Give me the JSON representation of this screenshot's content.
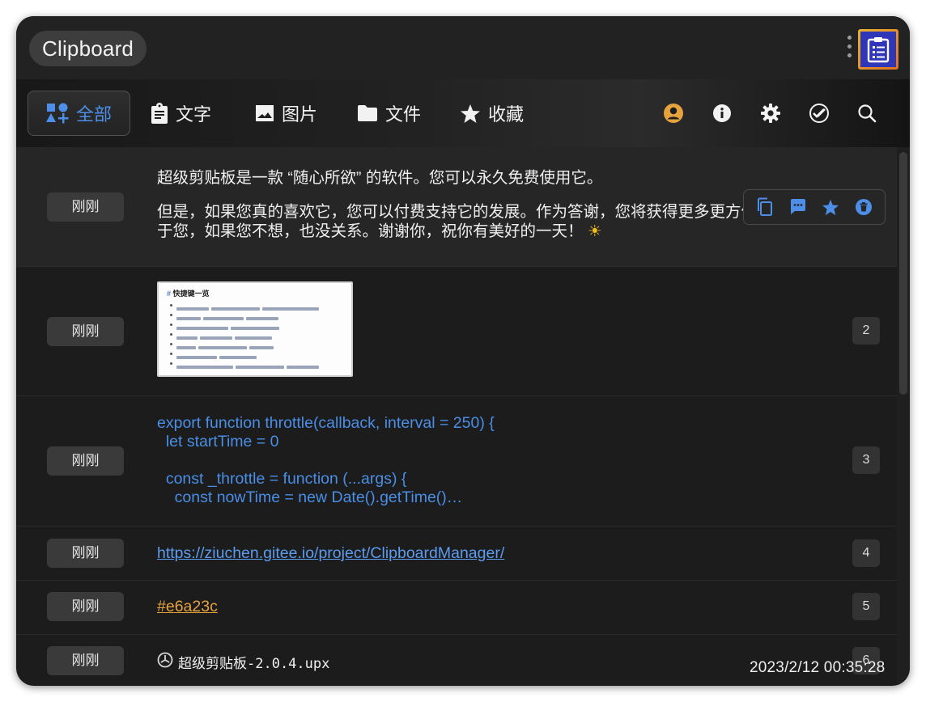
{
  "app": {
    "title": "Clipboard"
  },
  "tabs": [
    {
      "label": "全部",
      "icon": "shapes-icon",
      "active": true
    },
    {
      "label": "文字",
      "icon": "clipboard-text-icon"
    },
    {
      "label": "图片",
      "icon": "image-icon"
    },
    {
      "label": "文件",
      "icon": "folder-icon"
    },
    {
      "label": "收藏",
      "icon": "star-icon"
    }
  ],
  "toolbar_icons": [
    "account-icon",
    "info-icon",
    "settings-icon",
    "check-all-icon",
    "search-icon"
  ],
  "colors": {
    "accent": "#4d8fe8",
    "account": "#e6a23c",
    "color_item": "#e6a23c",
    "link": "#5b9cf0"
  },
  "items": [
    {
      "time": "刚刚",
      "lines": [
        "超级剪贴板是一款 “随心所欲” 的软件。您可以永久免费使用它。",
        "但是，如果您真的喜欢它，您可以付费支持它的发展。作为答谢，您将获得更多更方便",
        "于您，如果您不想，也没关系。谢谢你，祝你有美好的一天！"
      ],
      "emoji": "☀",
      "actions": [
        "copy-icon",
        "comment-icon",
        "star-icon",
        "delete-icon"
      ]
    },
    {
      "time": "刚刚",
      "number": "2",
      "thumbnail_title": "快捷键一览",
      "thumbnail_hash": "#"
    },
    {
      "time": "刚刚",
      "number": "3",
      "code_lines": [
        "export function throttle(callback, interval = 250) {",
        "  let startTime = 0",
        "",
        "  const _throttle = function (...args) {",
        "    const nowTime = new Date().getTime()…"
      ]
    },
    {
      "time": "刚刚",
      "number": "4",
      "link": "https://ziuchen.gitee.io/project/ClipboardManager/"
    },
    {
      "time": "刚刚",
      "number": "5",
      "color_text": "#e6a23c"
    },
    {
      "time": "刚刚",
      "number": "6",
      "file_name": "超级剪贴板-2.0.4.upx"
    }
  ],
  "datetime": "2023/2/12 00:35:28"
}
